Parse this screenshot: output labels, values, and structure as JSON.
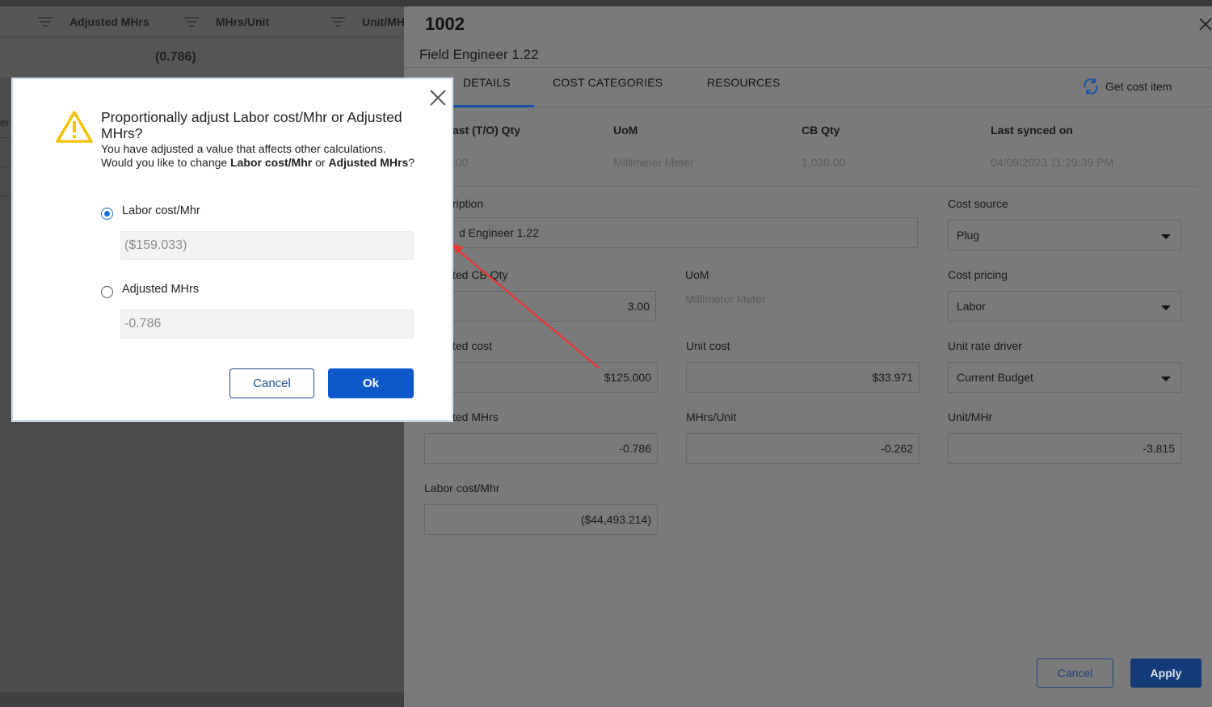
{
  "grid": {
    "columns": [
      "Adjusted MHrs",
      "MHrs/Unit",
      "Unit/MH"
    ],
    "row_value": "(0.786)",
    "edge_text": "er"
  },
  "panel": {
    "title": "1002",
    "subtitle": "Field Engineer 1.22",
    "tabs": [
      "DETAILS",
      "COST CATEGORIES",
      "RESOURCES"
    ],
    "active_tab": "DETAILS",
    "get_cost_item": "Get cost item",
    "sync": {
      "labels": [
        "ast (T/O) Qty",
        "UoM",
        "CB Qty",
        "Last synced on"
      ],
      "values": [
        ".00",
        "Millimeter Meter",
        "1,030.00",
        "04/09/2023 11:29:39 PM"
      ]
    },
    "fields": {
      "description_label": "ription",
      "description_value": "d Engineer 1.22",
      "cost_source_label": "Cost source",
      "cost_source_value": "Plug",
      "adj_cb_qty_label": "ted CB Qty",
      "adj_cb_qty_value": "3.00",
      "uom_label": "UoM",
      "uom_value": "Millimeter Meter",
      "cost_pricing_label": "Cost pricing",
      "cost_pricing_value": "Labor",
      "adj_cost_label": "ted cost",
      "adj_cost_value": "$125.000",
      "unit_cost_label": "Unit cost",
      "unit_cost_value": "$33.971",
      "unit_rate_driver_label": "Unit rate driver",
      "unit_rate_driver_value": "Current Budget",
      "adj_mhrs_label": "ted MHrs",
      "adj_mhrs_value": "-0.786",
      "mhrs_unit_label": "MHrs/Unit",
      "mhrs_unit_value": "-0.262",
      "unit_mhr_label": "Unit/MHr",
      "unit_mhr_value": "-3.815",
      "labor_cost_label": "Labor cost/Mhr",
      "labor_cost_value": "($44,493.214)"
    },
    "cancel_label": "Cancel",
    "apply_label": "Apply"
  },
  "modal": {
    "title": "Proportionally adjust Labor cost/Mhr or Adjusted MHrs?",
    "body_line1": "You have adjusted a value that affects other calculations.",
    "body_prefix": "Would you like to change ",
    "body_bold1": "Labor cost/Mhr",
    "body_mid": " or ",
    "body_bold2": "Adjusted MHrs",
    "body_suffix": "?",
    "option1_label": "Labor cost/Mhr",
    "option1_value": "($159.033)",
    "option1_selected": true,
    "option2_label": "Adjusted MHrs",
    "option2_value": "-0.786",
    "option2_selected": false,
    "cancel_label": "Cancel",
    "ok_label": "Ok"
  },
  "colors": {
    "primary": "#0e58c9",
    "warning": "#f5c400",
    "annotation": "#e03a3a"
  }
}
